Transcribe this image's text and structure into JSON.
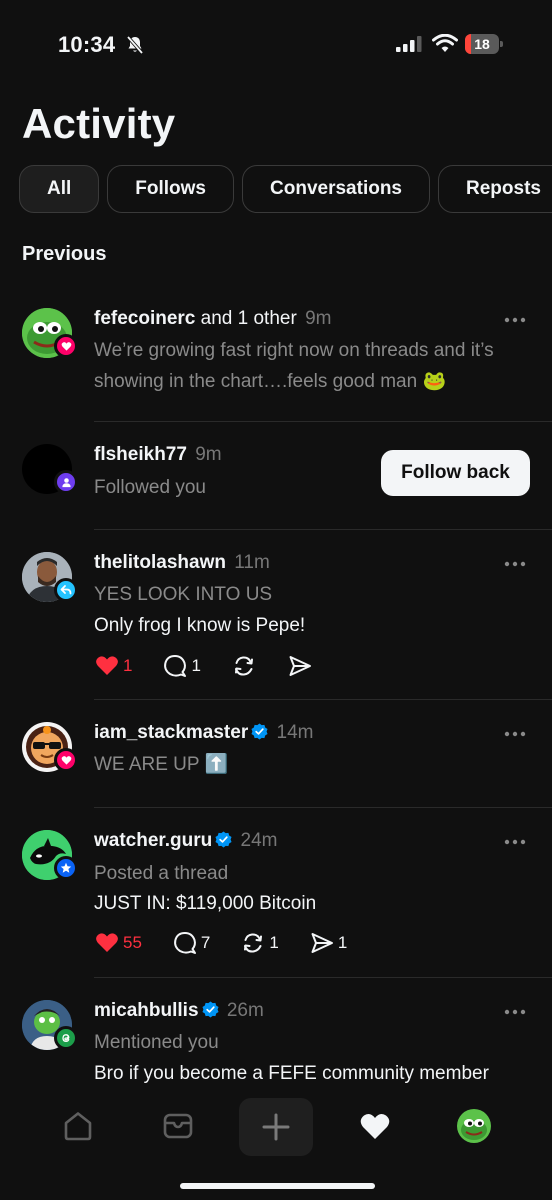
{
  "status_bar": {
    "time": "10:34",
    "battery": "18",
    "battery_level": 0.18,
    "battery_color": "#ff453a"
  },
  "header": {
    "title": "Activity"
  },
  "tabs": [
    {
      "label": "All",
      "active": true
    },
    {
      "label": "Follows",
      "active": false
    },
    {
      "label": "Conversations",
      "active": false
    },
    {
      "label": "Reposts",
      "active": false
    }
  ],
  "section_label": "Previous",
  "items": [
    {
      "username": "fefecoinerc",
      "extra": "and 1 other",
      "time": "9m",
      "badge": "heart-badge-icon",
      "subtext": "We’re growing fast right now on threads and it’s showing in the chart….feels good man 🐸"
    },
    {
      "username": "flsheikh77",
      "time": "9m",
      "badge": "person-badge-icon",
      "subtext": "Followed you",
      "button": "Follow back"
    },
    {
      "username": "thelitolashawn",
      "time": "11m",
      "badge": "reply-badge-icon",
      "subtext": "YES LOOK INTO US",
      "content": "Only frog I know is Pepe!",
      "likes": "1",
      "replies": "1"
    },
    {
      "username": "iam_stackmaster",
      "verified": true,
      "time": "14m",
      "badge": "heart-badge-icon",
      "subtext": "WE ARE UP ⬆️"
    },
    {
      "username": "watcher.guru",
      "verified": true,
      "time": "24m",
      "badge": "star-badge-icon",
      "subtext": "Posted a thread",
      "content": "JUST IN: $119,000 Bitcoin",
      "likes": "55",
      "replies": "7",
      "reposts": "1",
      "shares": "1"
    },
    {
      "username": "micahbullis",
      "verified": true,
      "time": "26m",
      "badge": "threads-badge-icon",
      "subtext": "Mentioned you",
      "content": "Bro if you become a FEFE community member"
    }
  ],
  "colors": {
    "background": "#101010",
    "like_red": "#ff3040",
    "heart_badge": "#fe0169",
    "person_badge": "#6e3def",
    "reply_badge": "#24c3ff",
    "star_badge": "#0a63f6",
    "threads_badge": "#1c9e4a",
    "verified_blue": "#0095f6"
  },
  "bottom_nav": [
    "home-icon",
    "inbox-icon",
    "new-thread-icon",
    "activity-heart-icon",
    "profile-avatar"
  ]
}
